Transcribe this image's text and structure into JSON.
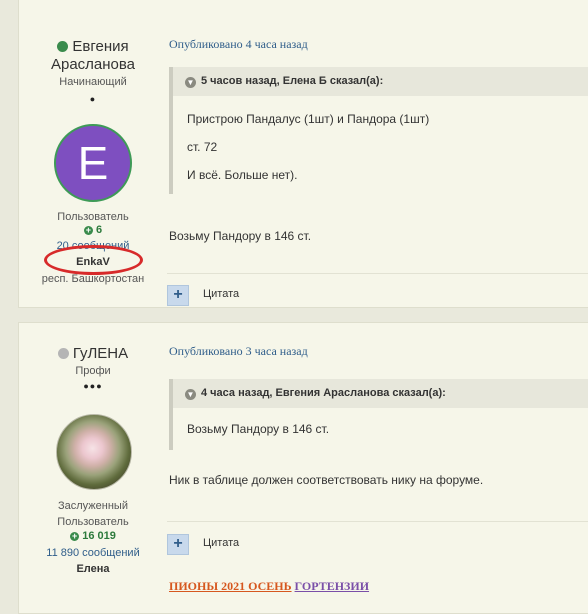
{
  "posts": [
    {
      "author": {
        "name_line1": "Евгения",
        "name_line2": "Арасланова",
        "online": true,
        "rank": "Начинающий",
        "pips": "●",
        "avatar_letter": "E",
        "avatar_color": "#7e4fc0",
        "group": "Пользователь",
        "reputation": "6",
        "posts_count": "20 сообщений",
        "nick": "EnkaV",
        "location": "респ. Башкортостан"
      },
      "date": "Опубликовано 4 часа назад",
      "quote": {
        "header": "5 часов назад, Елена Б сказал(а):",
        "lines": [
          "Пристрою Пандалус (1шт) и Пандора (1шт)",
          "ст. 72",
          "И всё. Больше нет)."
        ]
      },
      "text": "Возьму Пандору в 146 ст.",
      "cite_label": "Цитата"
    },
    {
      "author": {
        "name": "ГуЛЕНА",
        "online": false,
        "rank": "Профи",
        "pips": "●●●",
        "group_line1": "Заслуженный",
        "group_line2": "Пользователь",
        "reputation": "16 019",
        "posts_count": "11 890 сообщений",
        "nick": "Елена"
      },
      "date": "Опубликовано 3 часа назад",
      "quote": {
        "header": "4 часа назад, Евгения Арасланова сказал(а):",
        "lines": [
          "Возьму Пандору в 146 ст."
        ]
      },
      "text": "Ник в таблице должен соответствовать нику на форуме.",
      "cite_label": "Цитата",
      "signature": [
        "ПИОНЫ 2021 ОСЕНЬ",
        "ГОРТЕНЗИИ"
      ]
    }
  ],
  "colors": {
    "accent": "#2f5d8a",
    "online": "#3a8b4c",
    "offline": "#b5b5b5",
    "highlight": "#d72a2a"
  }
}
